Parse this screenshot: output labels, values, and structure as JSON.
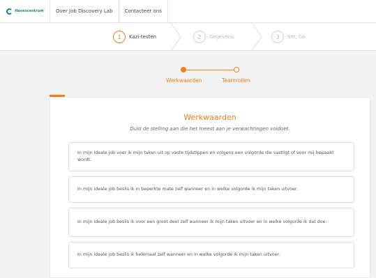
{
  "nav": {
    "brand": "Havencentrum",
    "items": [
      "Over Job Discovery Lab",
      "Contacteer ons"
    ]
  },
  "steps": [
    {
      "num": "1",
      "label": "Kazi-testen"
    },
    {
      "num": "2",
      "label": "Gegevens"
    },
    {
      "num": "3",
      "label": "Set, Go"
    }
  ],
  "progress": {
    "labels": [
      "Werkwaarden",
      "Teamrollen"
    ]
  },
  "card": {
    "title": "Werkwaarden",
    "subtitle": "Duid de stelling aan die het meest aan je verwachtingen voldoet.",
    "options": [
      "In mijn ideale job voer ik mijn taken uit op vaste tijdstippen en volgens een volgorde die vastligt of voor mij bepaald wordt.",
      "In mijn ideale job beslis ik in beperkte mate zelf wanneer en in welke volgorde ik mijn taken uitvoer.",
      "In mijn ideale job beslis ik voor een groot deel zelf wanneer ik mijn taken uitvoer en in welke volgorde ik dat doe.",
      "In mijn ideale job beslis ik helemaal zelf wanneer en in welke volgorde ik mijn taken uitvoer."
    ]
  },
  "colors": {
    "accent": "#ef7d1a",
    "brand": "#0a8a83"
  }
}
